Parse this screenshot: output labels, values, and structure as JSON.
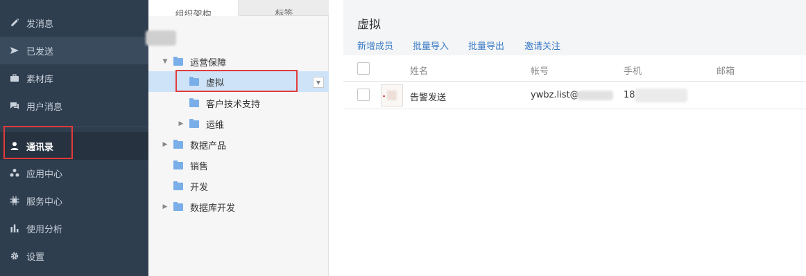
{
  "sidebar": {
    "items": [
      {
        "label": "发消息",
        "icon": "pencil-icon"
      },
      {
        "label": "已发送",
        "icon": "send-icon"
      },
      {
        "label": "素材库",
        "icon": "briefcase-icon"
      },
      {
        "label": "用户消息",
        "icon": "chat-icon"
      },
      {
        "label": "通讯录",
        "icon": "contact-icon"
      },
      {
        "label": "应用中心",
        "icon": "apps-icon"
      },
      {
        "label": "服务中心",
        "icon": "chip-icon"
      },
      {
        "label": "使用分析",
        "icon": "bar-chart-icon"
      },
      {
        "label": "设置",
        "icon": "gear-icon"
      }
    ],
    "active_item": "通讯录"
  },
  "tree_panel": {
    "tabs": [
      {
        "label": "组织架构",
        "active": true
      },
      {
        "label": "标签",
        "active": false
      }
    ],
    "nodes": [
      {
        "label": "运营保障",
        "expanded": true
      },
      {
        "label": "虚拟",
        "selected": true
      },
      {
        "label": "客户技术支持"
      },
      {
        "label": "运维",
        "expanded": false
      },
      {
        "label": "数据产品",
        "expanded": false
      },
      {
        "label": "销售"
      },
      {
        "label": "开发"
      },
      {
        "label": "数据库开发",
        "expanded": false
      }
    ]
  },
  "main": {
    "title": "虚拟",
    "actions": [
      "新增成员",
      "批量导入",
      "批量导出",
      "邀请关注"
    ],
    "columns": [
      "姓名",
      "帐号",
      "手机",
      "邮箱"
    ],
    "rows": [
      {
        "name": "告警发送",
        "account": "ywbz.list@",
        "phone": "18",
        "email": ""
      }
    ]
  },
  "colors": {
    "sidebar_bg": "#2f3e4f",
    "sidebar_active_bg": "#26323f",
    "link": "#3b7cc7",
    "highlight_border": "#e23a3a",
    "tree_selected_bg": "#cfe3f8",
    "folder": "#7aaee8"
  }
}
